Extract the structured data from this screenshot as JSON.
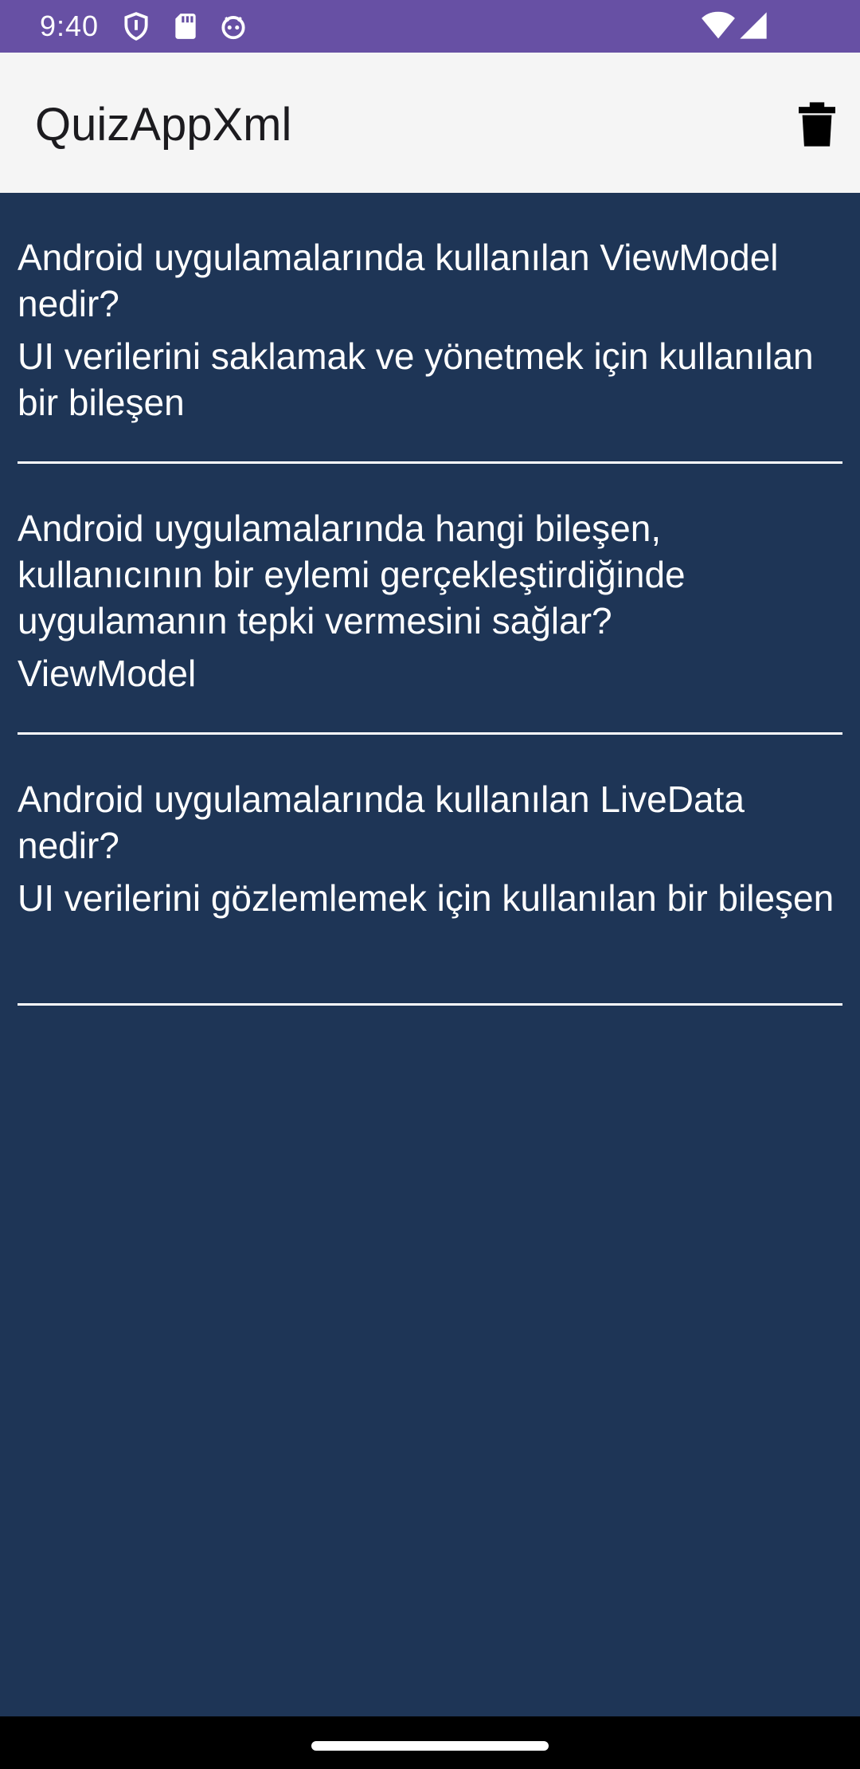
{
  "status_bar": {
    "time": "9:40",
    "icons": [
      "shield-icon",
      "sd-card-icon",
      "android-debug-icon",
      "wifi-icon",
      "cell-signal-icon"
    ]
  },
  "app_bar": {
    "title": "QuizAppXml",
    "action_icon": "trash-icon"
  },
  "quiz_items": [
    {
      "question": "Android uygulamalarında kullanılan ViewModel nedir?",
      "answer": "UI verilerini saklamak ve yönetmek için kullanılan bir bileşen"
    },
    {
      "question": "Android uygulamalarında hangi bileşen, kullanıcının bir eylemi gerçekleştirdiğinde uygulamanın tepki vermesini sağlar?",
      "answer": "ViewModel"
    },
    {
      "question": "Android uygulamalarında kullanılan LiveData nedir?",
      "answer": "UI verilerini gözlemlemek için kullanılan bir bileşen"
    }
  ],
  "colors": {
    "status_bar": "#6750a4",
    "app_bar": "#f5f5f5",
    "list_background": "#1e3556",
    "text": "#ffffff"
  }
}
